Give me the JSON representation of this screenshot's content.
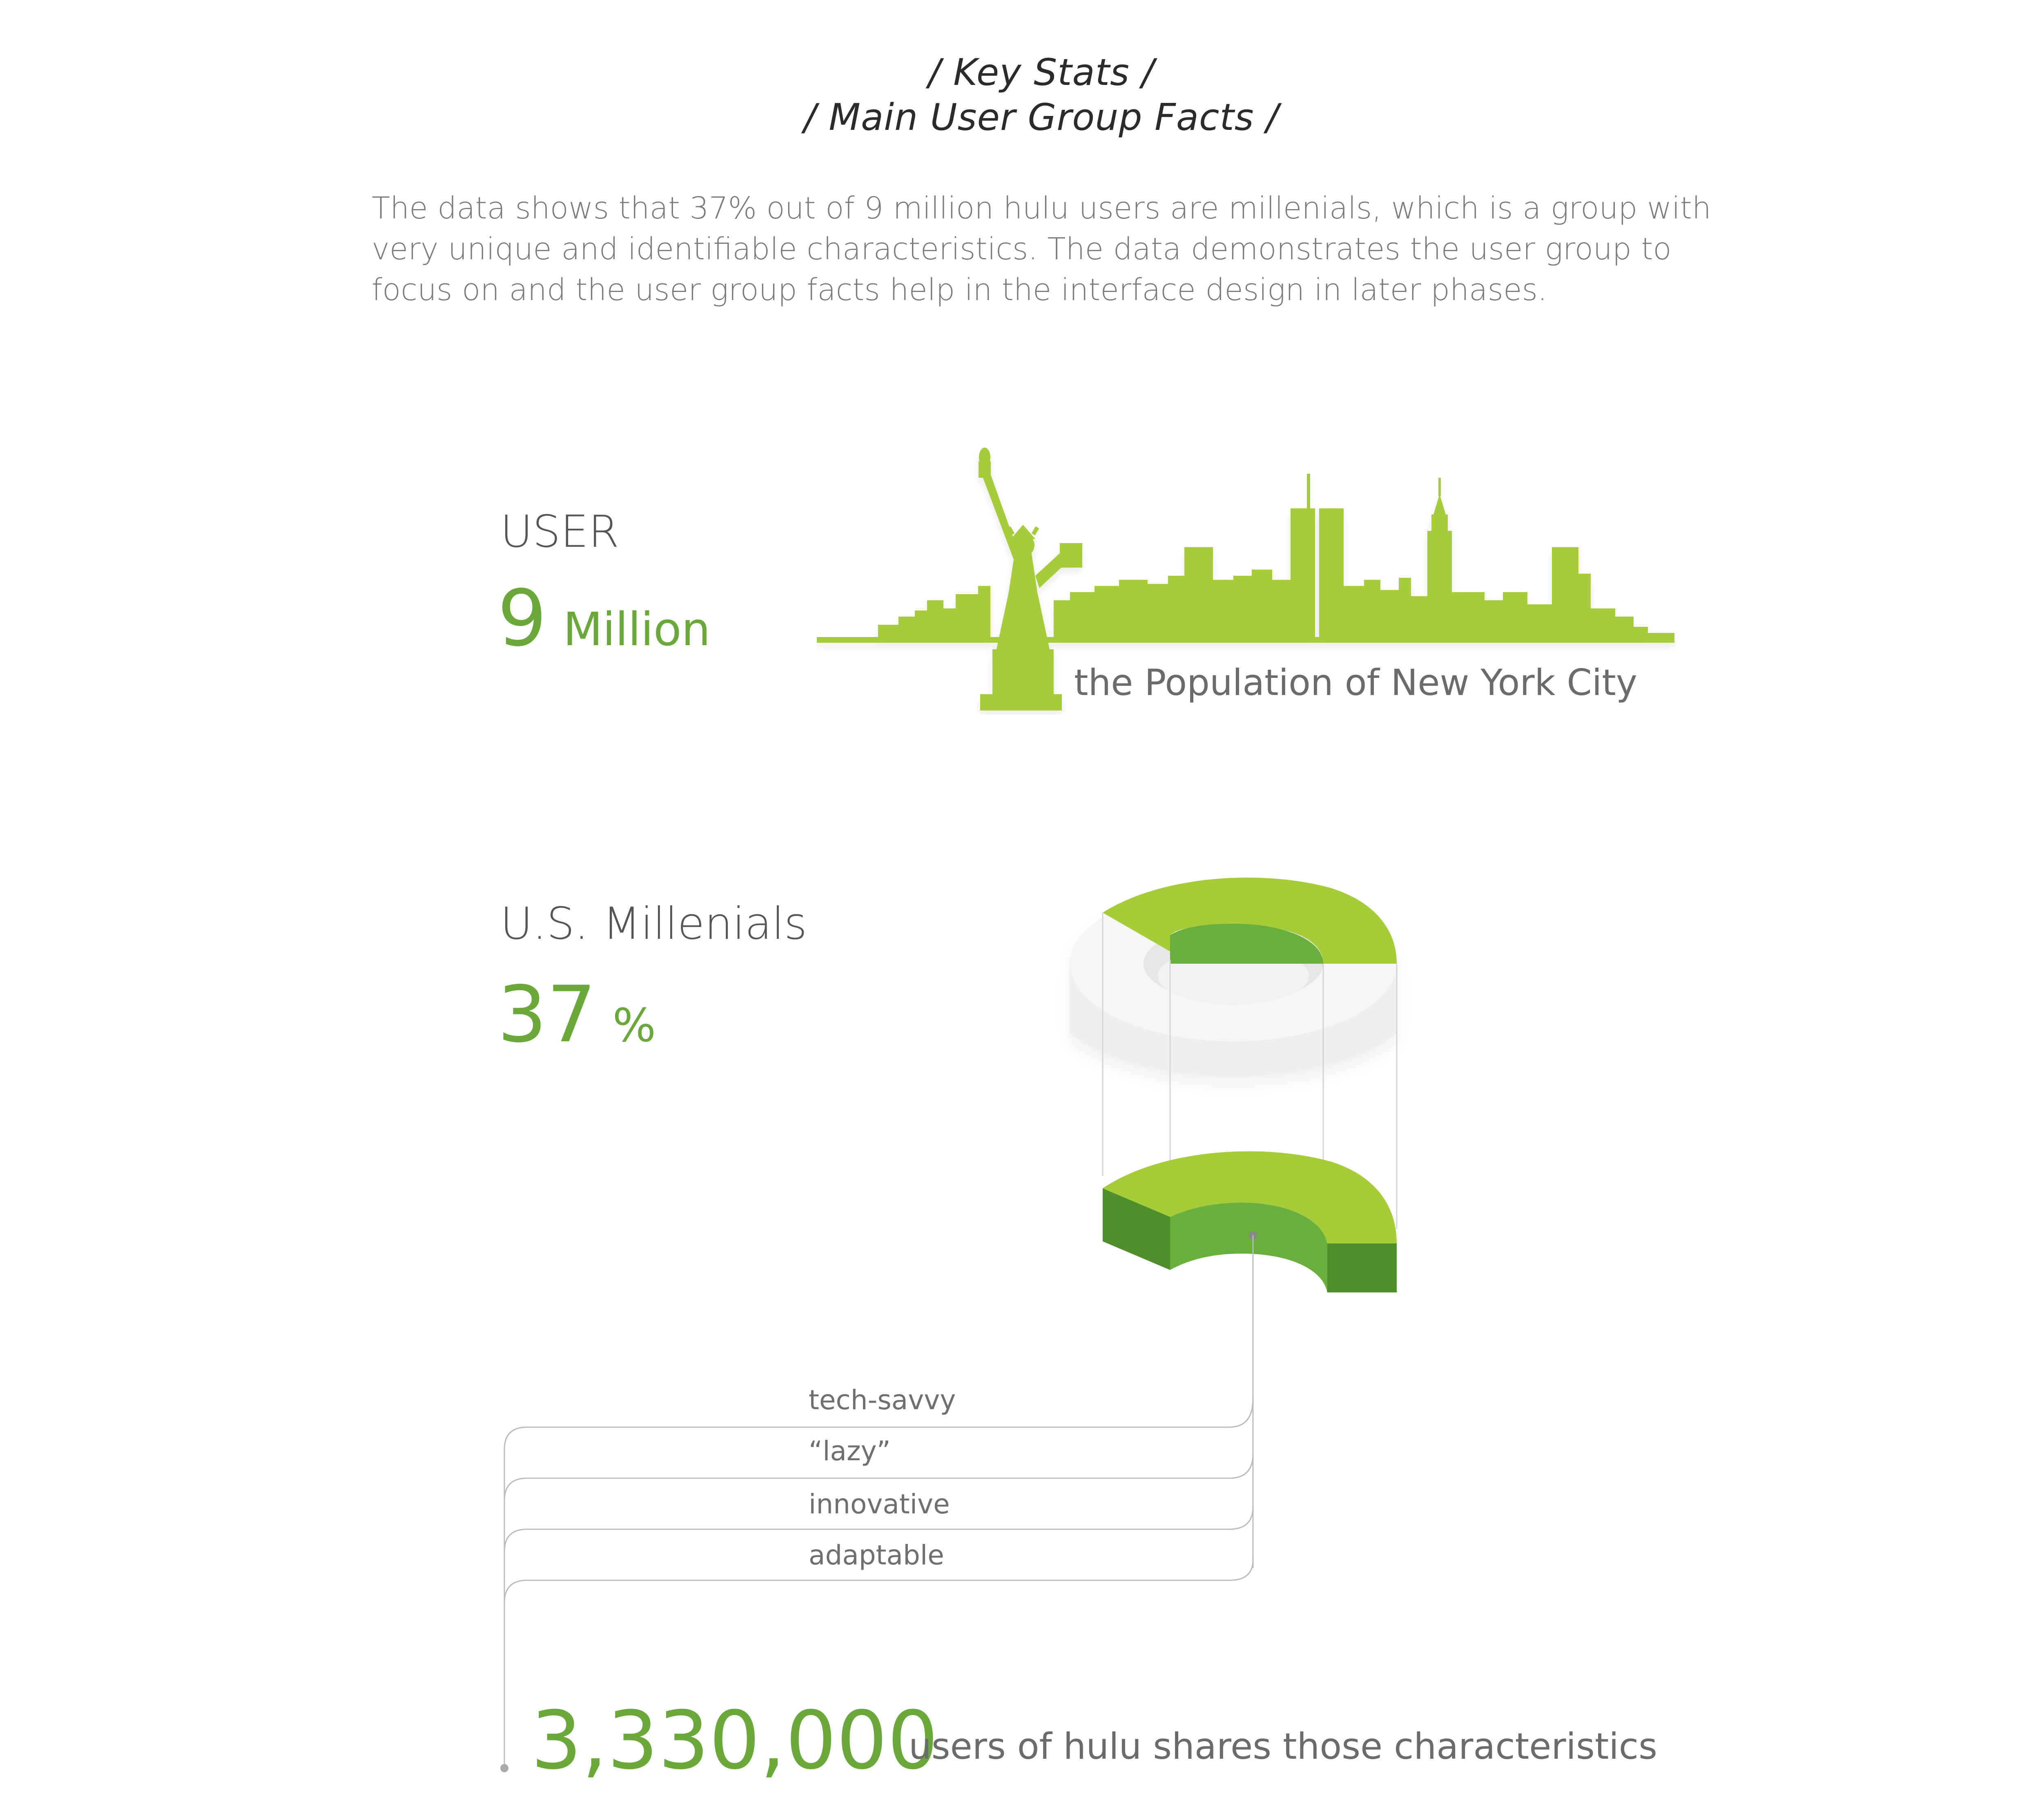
{
  "header": {
    "line1": "/ Key Stats /",
    "line2": "/ Main User Group Facts /"
  },
  "intro": "The data shows that 37% out of 9 million hulu users are millenials, which is a group with very unique and identifiable characteristics. The data demonstrates the user group to focus on and the user group facts help in the interface design in later phases.",
  "user_stat": {
    "label": "USER",
    "value": "9",
    "unit": "Million",
    "comparison": "the Population of New York City"
  },
  "millenial_stat": {
    "label": "U.S. Millenials",
    "value": "37",
    "unit": "%",
    "fraction": 0.37
  },
  "traits": [
    "tech-savvy",
    "“lazy”",
    "innovative",
    "adaptable"
  ],
  "result": {
    "value": "3,330,000",
    "text": "users of hulu shares those characteristics"
  },
  "colors": {
    "green_light": "#a6cc3a",
    "green_mid": "#6aae3e",
    "green_dark": "#4f8f2b",
    "text_green": "#6aa83c",
    "ring_gray": "#eeeeee"
  },
  "icons": {
    "skyline": "new-york-skyline-icon",
    "statue": "statue-of-liberty-icon"
  }
}
